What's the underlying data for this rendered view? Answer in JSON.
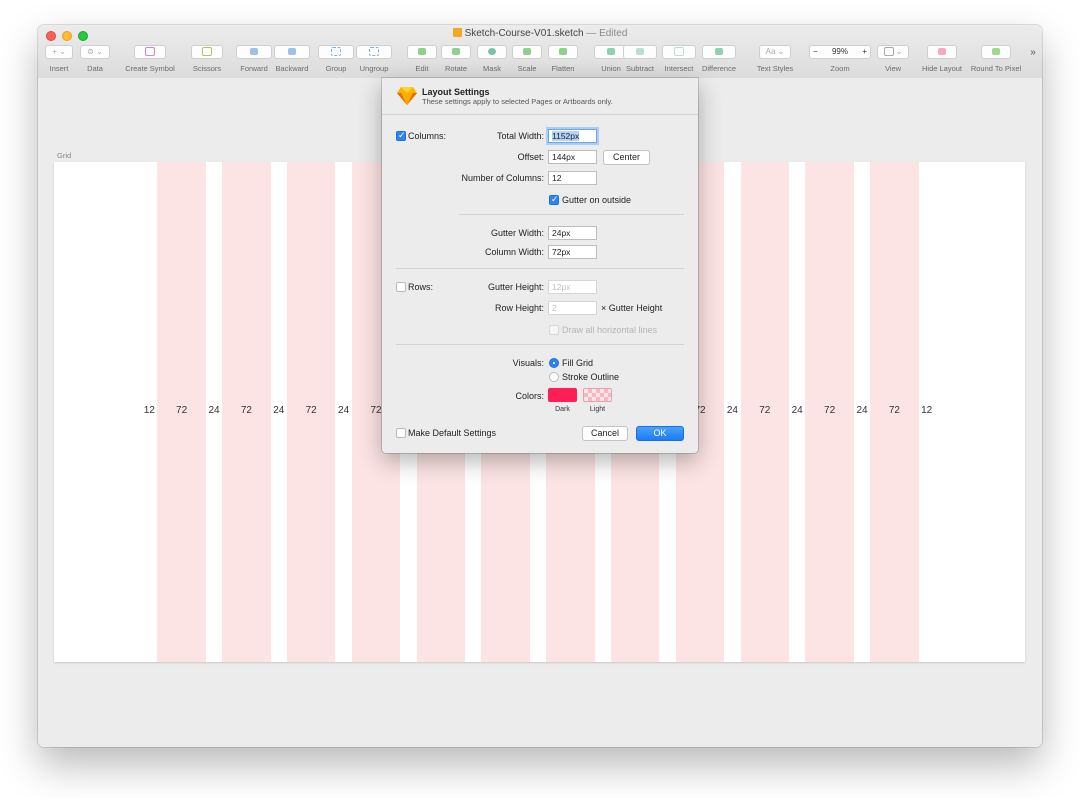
{
  "window": {
    "title": "Sketch-Course-V01.sketch",
    "title_status": "— Edited"
  },
  "toolbar": {
    "insert": "Insert",
    "insert_glyph": "+ ⌄",
    "data": "Data",
    "data_glyph": "⊜ ⌄",
    "create_symbol": "Create Symbol",
    "scissors": "Scissors",
    "forward": "Forward",
    "backward": "Backward",
    "group": "Group",
    "ungroup": "Ungroup",
    "edit": "Edit",
    "rotate": "Rotate",
    "mask": "Mask",
    "scale": "Scale",
    "flatten": "Flatten",
    "union": "Union",
    "subtract": "Subtract",
    "intersect": "Intersect",
    "difference": "Difference",
    "text_styles": "Text Styles",
    "text_styles_glyph": "Aa ⌄",
    "zoom": "Zoom",
    "zoom_minus": "−",
    "zoom_value": "99%",
    "zoom_plus": "+",
    "view": "View",
    "hide_layout": "Hide Layout",
    "round_to_pixel": "Round To Pixel",
    "overflow": "»"
  },
  "canvas": {
    "artboard_name": "Grid",
    "grid_color": "#fde4e4",
    "measurements": [
      "12",
      "72",
      "24",
      "72",
      "24",
      "72",
      "24",
      "72",
      "72",
      "24",
      "72",
      "24",
      "72",
      "24",
      "72",
      "12"
    ]
  },
  "dialog": {
    "title": "Layout Settings",
    "subtitle": "These settings apply to selected Pages or Artboards only.",
    "columns_label": "Columns:",
    "columns_checked": true,
    "total_width_label": "Total Width:",
    "total_width_value": "1152px",
    "offset_label": "Offset:",
    "offset_value": "144px",
    "center_button": "Center",
    "num_columns_label": "Number of Columns:",
    "num_columns_value": "12",
    "gutter_outside_label": "Gutter on outside",
    "gutter_outside_checked": true,
    "gutter_width_label": "Gutter Width:",
    "gutter_width_value": "24px",
    "column_width_label": "Column Width:",
    "column_width_value": "72px",
    "rows_label": "Rows:",
    "rows_checked": false,
    "gutter_height_label": "Gutter Height:",
    "gutter_height_placeholder": "12px",
    "row_height_label": "Row Height:",
    "row_height_placeholder": "2",
    "row_height_suffix": "× Gutter Height",
    "draw_lines_label": "Draw all horizontal lines",
    "visuals_label": "Visuals:",
    "fill_grid_label": "Fill Grid",
    "stroke_outline_label": "Stroke Outline",
    "visual_selected": "Fill Grid",
    "colors_label": "Colors:",
    "dark_label": "Dark",
    "light_label": "Light",
    "dark_color": "#ff1f55",
    "make_default_label": "Make Default Settings",
    "cancel_button": "Cancel",
    "ok_button": "OK"
  }
}
